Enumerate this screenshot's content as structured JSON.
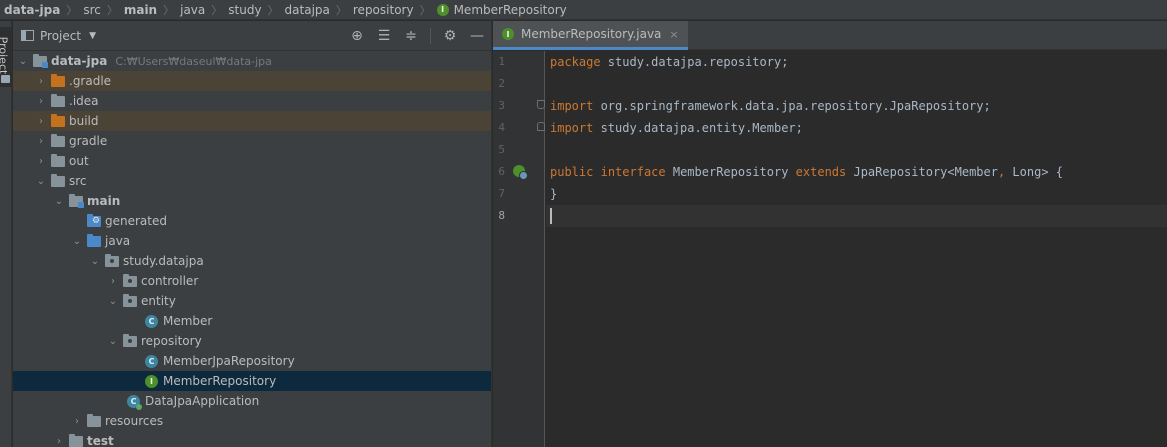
{
  "breadcrumb": {
    "items": [
      "data-jpa",
      "src",
      "main",
      "java",
      "study",
      "datajpa",
      "repository",
      "MemberRepository"
    ],
    "separator": "〉"
  },
  "tool_strip": {
    "label": "Project"
  },
  "project_panel": {
    "title": "Project",
    "tool_icons": [
      "locate-icon",
      "expand-all-icon",
      "collapse-all-icon",
      "gear-icon",
      "minimize-icon"
    ],
    "tree": [
      {
        "label": "data-jpa",
        "path": "C:₩Users₩daseul₩data-jpa"
      },
      {
        "label": ".gradle"
      },
      {
        "label": ".idea"
      },
      {
        "label": "build"
      },
      {
        "label": "gradle"
      },
      {
        "label": "out"
      },
      {
        "label": "src"
      },
      {
        "label": "main"
      },
      {
        "label": "generated"
      },
      {
        "label": "java"
      },
      {
        "label": "study.datajpa"
      },
      {
        "label": "controller"
      },
      {
        "label": "entity"
      },
      {
        "label": "Member"
      },
      {
        "label": "repository"
      },
      {
        "label": "MemberJpaRepository"
      },
      {
        "label": "MemberRepository"
      },
      {
        "label": "DataJpaApplication"
      },
      {
        "label": "resources"
      },
      {
        "label": "test"
      }
    ]
  },
  "editor": {
    "tab": {
      "label": "MemberRepository.java",
      "close": "×"
    },
    "line_numbers": [
      "1",
      "2",
      "3",
      "4",
      "5",
      "6",
      "7",
      "8"
    ],
    "code": {
      "l1_kw": "package",
      "l1_rest": " study.datajpa.repository;",
      "l3_kw": "import",
      "l3_rest": " org.springframework.data.jpa.repository.JpaRepository;",
      "l4_kw": "import",
      "l4_rest": " study.datajpa.entity.Member;",
      "l6_kw1": "public",
      "l6_kw2": "interface",
      "l6_name": " MemberRepository ",
      "l6_kw3": "extends",
      "l6_type": " JpaRepository<Member",
      "l6_comma": ",",
      "l6_end": " Long> {",
      "l7": "}"
    }
  },
  "colors": {
    "background": "#2b2b2b",
    "panel": "#3c3f41",
    "keyword": "#cc7832",
    "text": "#a9b7c6",
    "selection": "#0d293e",
    "excluded_highlight": "#4b4336",
    "interface_icon": "#4d8f2a",
    "class_icon": "#3e86a0"
  }
}
